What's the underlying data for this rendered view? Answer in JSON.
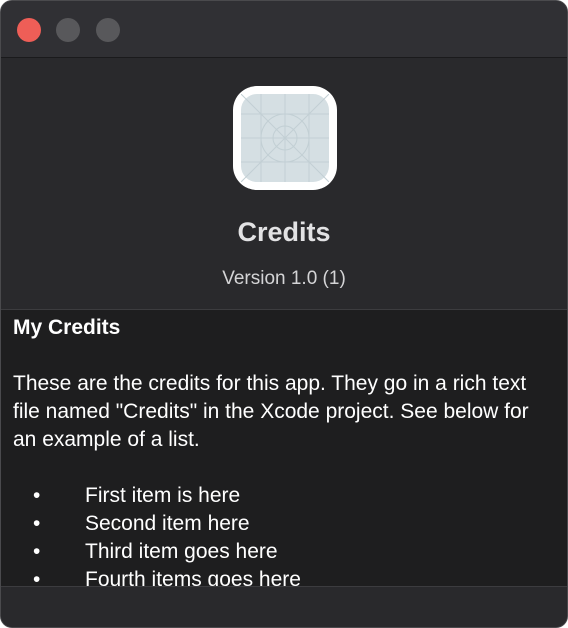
{
  "window": {
    "traffic_lights": [
      "close",
      "minimize",
      "zoom"
    ]
  },
  "about": {
    "app_icon": "app-icon-placeholder",
    "app_name": "Credits",
    "version": "Version 1.0 (1)"
  },
  "credits": {
    "heading": "My Credits",
    "paragraph": "These are the credits for this app. They go in a rich text file named \"Credits\" in the Xcode project. See below for an example of a list.",
    "bullet": "•",
    "items": [
      "First item is here",
      "Second item here",
      "Third item goes here",
      "Fourth items goes here"
    ]
  },
  "colors": {
    "window_bg": "#29292c",
    "credits_bg": "#1e1e1f",
    "close_button": "#ee5e57",
    "inactive_button": "#58585b"
  }
}
